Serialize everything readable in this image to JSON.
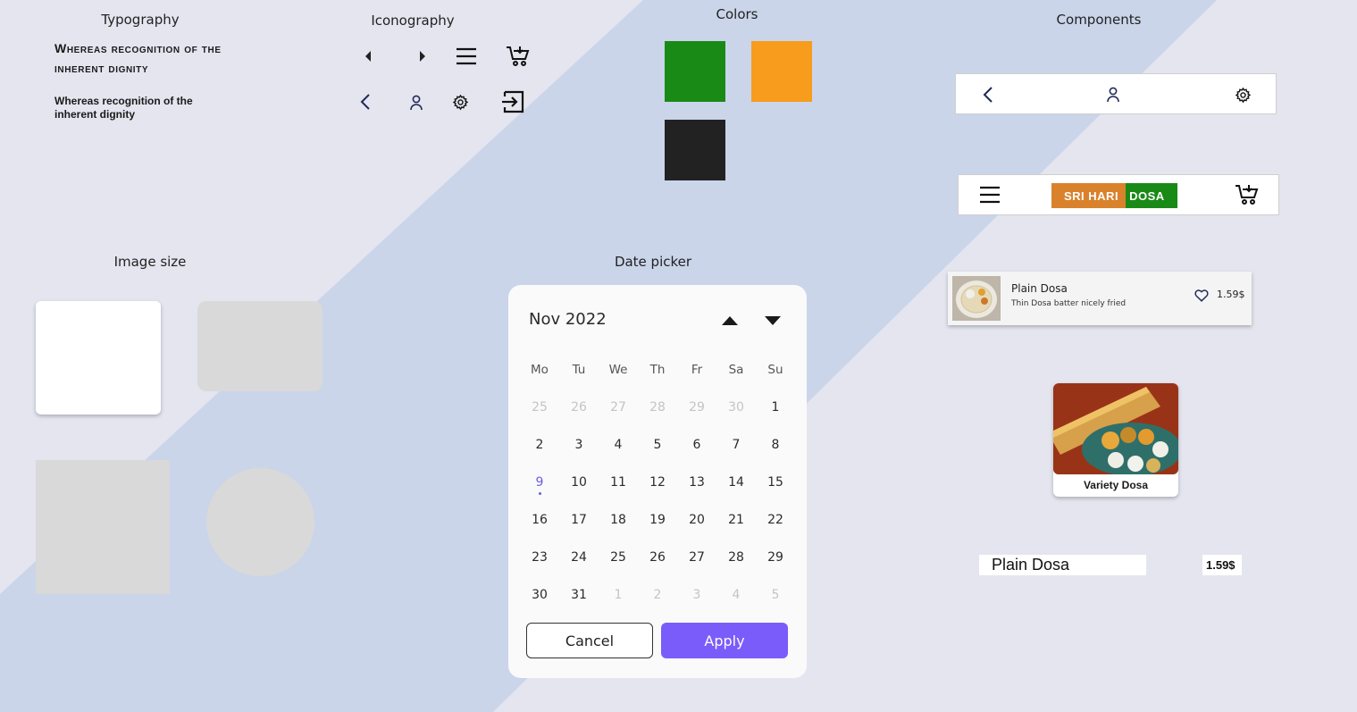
{
  "sections": {
    "typography": "Typography",
    "iconography": "Iconography",
    "colors": "Colors",
    "components": "Components",
    "image_size": "Image size",
    "date_picker": "Date picker"
  },
  "typography": {
    "heading_sample": "Whereas recognition of the inherent dignity",
    "body_sample": "Whereas recognition of the inherent dignity"
  },
  "iconography": {
    "row1": [
      "caret-left-icon",
      "caret-right-icon",
      "menu-icon",
      "cart-icon"
    ],
    "row2": [
      "chevron-left-icon",
      "user-icon",
      "settings-icon",
      "logout-icon"
    ]
  },
  "colors": {
    "swatches": [
      "#1a8a16",
      "#f79c1c",
      "#222222"
    ]
  },
  "datepicker": {
    "month_label": "Nov 2022",
    "weekdays": [
      "Mo",
      "Tu",
      "We",
      "Th",
      "Fr",
      "Sa",
      "Su"
    ],
    "weeks": [
      [
        "25",
        "26",
        "27",
        "28",
        "29",
        "30",
        "1"
      ],
      [
        "2",
        "3",
        "4",
        "5",
        "6",
        "7",
        "8"
      ],
      [
        "9",
        "10",
        "11",
        "12",
        "13",
        "14",
        "15"
      ],
      [
        "16",
        "17",
        "18",
        "19",
        "20",
        "21",
        "22"
      ],
      [
        "23",
        "24",
        "25",
        "26",
        "27",
        "28",
        "29"
      ],
      [
        "30",
        "31",
        "1",
        "2",
        "3",
        "4",
        "5"
      ]
    ],
    "today": "9",
    "cancel_label": "Cancel",
    "apply_label": "Apply",
    "accent_color": "#7a5cfa"
  },
  "components": {
    "brand_part1": "SRI HARI",
    "brand_part2": "DOSA",
    "menu_item": {
      "title": "Plain Dosa",
      "subtitle": "Thin Dosa batter nicely fried",
      "price": "1.59$"
    },
    "food_card_title": "Variety Dosa",
    "price_row": {
      "name": "Plain Dosa",
      "price": "1.59$"
    }
  }
}
